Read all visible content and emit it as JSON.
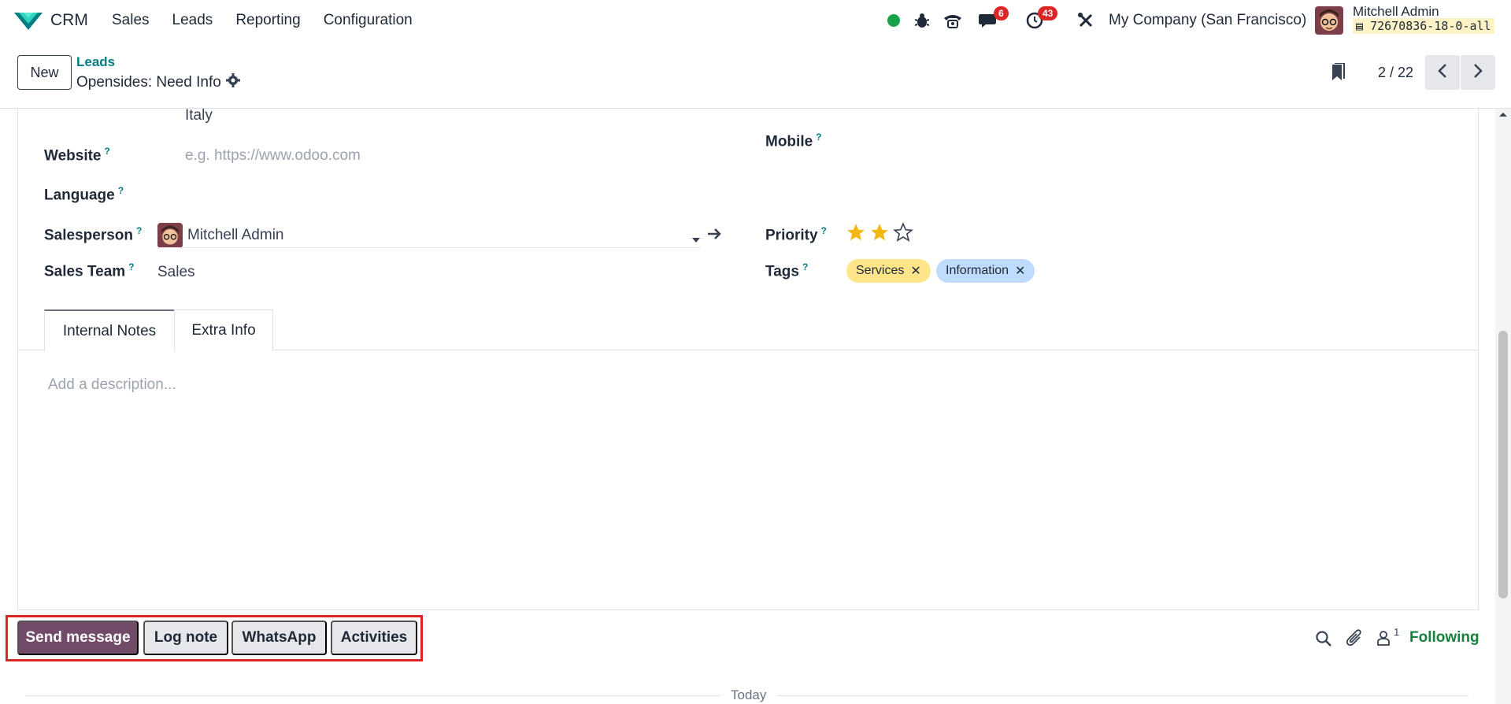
{
  "navbar": {
    "app_name": "CRM",
    "menu": [
      "Sales",
      "Leads",
      "Reporting",
      "Configuration"
    ],
    "messages_count": "6",
    "activities_count": "43",
    "company": "My Company (San Francisco)",
    "user_name": "Mitchell Admin",
    "database": "72670836-18-0-all"
  },
  "control_panel": {
    "new_label": "New",
    "breadcrumb_parent": "Leads",
    "breadcrumb_current": "Opensides: Need Info",
    "pager": "2 / 22"
  },
  "form": {
    "country_value": "Italy",
    "website_label": "Website",
    "website_placeholder": "e.g. https://www.odoo.com",
    "language_label": "Language",
    "salesperson_label": "Salesperson",
    "salesperson_value": "Mitchell Admin",
    "sales_team_label": "Sales Team",
    "sales_team_value": "Sales",
    "mobile_label": "Mobile",
    "priority_label": "Priority",
    "priority_stars": 2,
    "priority_max": 3,
    "tags_label": "Tags",
    "tags": [
      {
        "label": "Services",
        "color": "#fde68a"
      },
      {
        "label": "Information",
        "color": "#bfdbfe"
      }
    ],
    "help_mark": "?"
  },
  "tabs": {
    "internal_notes": "Internal Notes",
    "extra_info": "Extra Info"
  },
  "notes": {
    "placeholder": "Add a description..."
  },
  "chatter": {
    "send_message": "Send message",
    "log_note": "Log note",
    "whatsapp": "WhatsApp",
    "activities": "Activities",
    "followers_count": "1",
    "following": "Following",
    "today": "Today"
  },
  "colors": {
    "primary": "#714b67",
    "link": "#017e84",
    "following": "#16803c",
    "highlight": "#dc2626"
  }
}
